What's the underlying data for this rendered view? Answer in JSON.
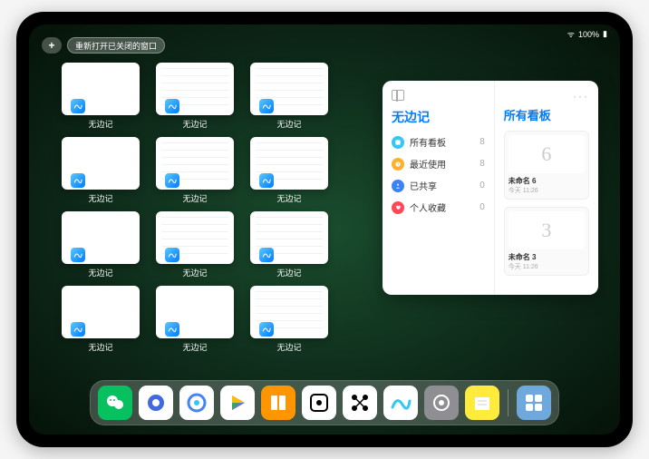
{
  "status": {
    "signal": "􀙇",
    "battery": "100%"
  },
  "topbar": {
    "add": "+",
    "reopen": "重新打开已关闭的窗口"
  },
  "windows": [
    {
      "label": "无边记",
      "variant": "blank"
    },
    {
      "label": "无边记",
      "variant": "list"
    },
    {
      "label": "无边记",
      "variant": "list"
    },
    {
      "label": "无边记",
      "variant": "blank"
    },
    {
      "label": "无边记",
      "variant": "list"
    },
    {
      "label": "无边记",
      "variant": "list"
    },
    {
      "label": "无边记",
      "variant": "blank"
    },
    {
      "label": "无边记",
      "variant": "list"
    },
    {
      "label": "无边记",
      "variant": "list"
    },
    {
      "label": "无边记",
      "variant": "blank"
    },
    {
      "label": "无边记",
      "variant": "blank"
    },
    {
      "label": "无边记",
      "variant": "list"
    }
  ],
  "panel": {
    "title": "无边记",
    "right_title": "所有看板",
    "more": "···",
    "categories": [
      {
        "label": "所有看板",
        "count": "8",
        "color": "#34c7f5"
      },
      {
        "label": "最近使用",
        "count": "8",
        "color": "#ffb02e"
      },
      {
        "label": "已共享",
        "count": "0",
        "color": "#3b82f6"
      },
      {
        "label": "个人收藏",
        "count": "0",
        "color": "#ff4757"
      }
    ],
    "boards": [
      {
        "name": "未命名 6",
        "date": "今天 11:26",
        "glyph": "6"
      },
      {
        "name": "未命名 3",
        "date": "今天 11:26",
        "glyph": "3"
      }
    ]
  },
  "dock": [
    {
      "name": "wechat",
      "bg": "#07c160"
    },
    {
      "name": "quark",
      "bg": "#ffffff"
    },
    {
      "name": "browser",
      "bg": "#ffffff"
    },
    {
      "name": "play-color",
      "bg": "#ffffff"
    },
    {
      "name": "books",
      "bg": "#ff9500"
    },
    {
      "name": "widget",
      "bg": "#ffffff"
    },
    {
      "name": "connect-dots",
      "bg": "#ffffff"
    },
    {
      "name": "freeform",
      "bg": "#ffffff"
    },
    {
      "name": "settings",
      "bg": "#8e8e93"
    },
    {
      "name": "notes",
      "bg": "#ffeb3b"
    },
    {
      "name": "app-library",
      "bg": "#6fa8dc"
    }
  ]
}
